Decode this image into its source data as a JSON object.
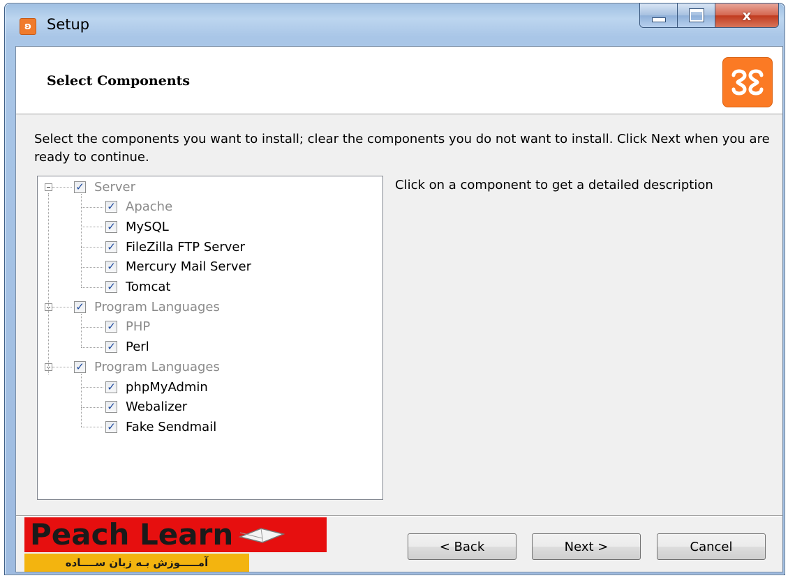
{
  "window": {
    "title": "Setup",
    "close_glyph": "x"
  },
  "header": {
    "title": "Select Components"
  },
  "instructions": "Select the components you want to install; clear the components you do not want to install. Click Next when you are ready to continue.",
  "description_hint": "Click on a component to get a detailed description",
  "tree": {
    "groups": [
      {
        "label": "Server",
        "checked": true,
        "dimmed": true,
        "items": [
          {
            "label": "Apache",
            "checked": true,
            "dimmed": true
          },
          {
            "label": "MySQL",
            "checked": true,
            "dimmed": false
          },
          {
            "label": "FileZilla FTP Server",
            "checked": true,
            "dimmed": false
          },
          {
            "label": "Mercury Mail Server",
            "checked": true,
            "dimmed": false
          },
          {
            "label": "Tomcat",
            "checked": true,
            "dimmed": false
          }
        ]
      },
      {
        "label": "Program Languages",
        "checked": true,
        "dimmed": true,
        "items": [
          {
            "label": "PHP",
            "checked": true,
            "dimmed": true
          },
          {
            "label": "Perl",
            "checked": true,
            "dimmed": false
          }
        ]
      },
      {
        "label": "Program Languages",
        "checked": true,
        "dimmed": true,
        "items": [
          {
            "label": "phpMyAdmin",
            "checked": true,
            "dimmed": false
          },
          {
            "label": "Webalizer",
            "checked": true,
            "dimmed": false
          },
          {
            "label": "Fake Sendmail",
            "checked": true,
            "dimmed": false
          }
        ]
      }
    ]
  },
  "buttons": {
    "back": "< Back",
    "next": "Next >",
    "cancel": "Cancel"
  },
  "watermark": {
    "title": "Peach Learn",
    "subtitle": "آمـــــوزش بـه زبان ســــاده"
  },
  "colors": {
    "accent_orange": "#fb7a24",
    "watermark_red": "#e60f0f",
    "watermark_yellow": "#f3b40f"
  }
}
